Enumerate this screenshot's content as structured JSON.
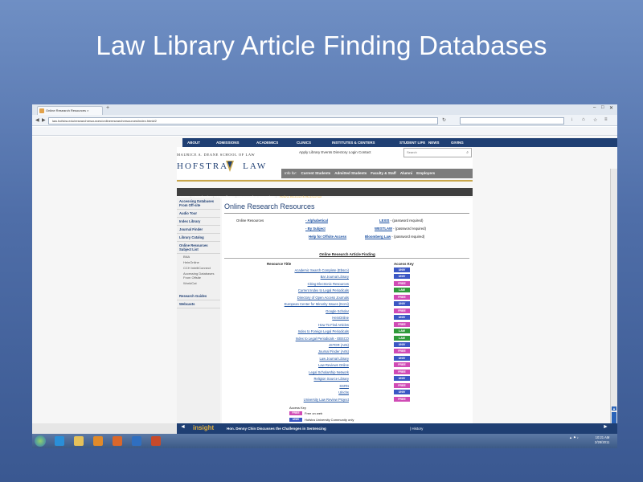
{
  "slide": {
    "title": "Law Library Article Finding Databases"
  },
  "browser": {
    "tab_title": "Online Research Resources ×",
    "new_tab": "+",
    "url": "law.hofstra.edu/researchresources/onlineresearchresources/index.html#2",
    "bookmarks": [
      "Hofstra Portal",
      "Hofstra Law School",
      "Deane Law Library",
      "Lexis",
      "Online Databases",
      "LexisNexis",
      "PBWiki",
      "HeinOnline",
      "Westlaw",
      "Worldcat",
      "Journal Finder",
      "Bluebook",
      "Most Visited",
      "Getting Started",
      "Latest Headlines",
      "Most Visited",
      "LibGuides Law Index"
    ]
  },
  "site": {
    "topnav": [
      "ABOUT",
      "ADMISSIONS",
      "ACADEMICS",
      "CLINICS",
      "INSTITUTES & CENTERS",
      "STUDENT LIFE",
      "NEWS",
      "GIVING"
    ],
    "school_name": "MAURICE A. DEANE SCHOOL OF LAW",
    "wordmark_left": "HOFSTRA",
    "wordmark_right": "LAW",
    "utility_links": "Apply   Library   Events   Directory   Login   Contact",
    "search_placeholder": "Search",
    "audience_label": "Info for:",
    "audience": [
      "Current Students",
      "Admitted Students",
      "Faculty & Staff",
      "Alumni",
      "Employers"
    ],
    "breadcrumb": [
      "Home",
      "Academics",
      "Law Library",
      "Research & Instruction",
      "Online Research Resources"
    ],
    "sidebar": {
      "items": [
        "Accessing Databases From Off-site",
        "Audio Tour",
        "Index Library",
        "Journal Finder",
        "Library Catalog",
        "Online Resources Subject List"
      ],
      "subitems": [
        "BNA",
        "HeinOnline",
        "CCH IntelliConnect",
        "Accessing Databases From Offsite",
        "WorldCat"
      ],
      "lower_items": [
        "Research Guides",
        "Webcasts"
      ]
    },
    "content": {
      "heading": "Online Research Resources",
      "or_label": "Online Resources",
      "or_links": [
        "- Alphabetical",
        "- By Subject",
        "Help for Offsite Access"
      ],
      "lexis": "LEXIS",
      "lexis_note": " - (password required)",
      "westlaw": "WESTLAW",
      "westlaw_note": " - (password required)",
      "bloomberg": "Bloomberg Law",
      "bloomberg_note": " - (password required)",
      "finding_title": "Online Research Article Finding",
      "col_title": "Resource Title",
      "col_key": "Access Key",
      "rows": [
        {
          "name": "Academic Search Complete (Ebsco)",
          "key": "UNIV"
        },
        {
          "name": "Bar Journal Library",
          "key": "UNIV"
        },
        {
          "name": "Citing Electronic Resources",
          "key": "FREE"
        },
        {
          "name": "Current Index to Legal Periodicals",
          "key": "LAW"
        },
        {
          "name": "Directory of Open Access Journals",
          "key": "FREE"
        },
        {
          "name": "European Center for Minority Issues (Ecmi)",
          "key": "UNIV"
        },
        {
          "name": "Google Scholar",
          "key": "FREE"
        },
        {
          "name": "HeinOnline",
          "key": "UNIV"
        },
        {
          "name": "How To Find Articles",
          "key": "FREE"
        },
        {
          "name": "Index to Foreign Legal Periodicals",
          "key": "LAW"
        },
        {
          "name": "Index to Legal Periodicals - EBSCO",
          "key": "LAW"
        },
        {
          "name": "JSTOR (Arts)",
          "key": "UNIV"
        },
        {
          "name": "Journal Finder (Arts)",
          "key": "FREE"
        },
        {
          "name": "Law Journal Library",
          "key": "UNIV"
        },
        {
          "name": "Law Reviews Online",
          "key": "FREE"
        },
        {
          "name": "Legal Scholarship Network",
          "key": "FREE"
        },
        {
          "name": "Religion Source Library",
          "key": "UNIV"
        },
        {
          "name": "SSRN",
          "key": "FREE"
        },
        {
          "name": "Ulrichs",
          "key": "UNIV"
        },
        {
          "name": "University Law Review Project",
          "key": "FREE"
        }
      ],
      "legend_title": "Access Key",
      "legend": [
        {
          "label": "FREE",
          "text": "Free on web"
        },
        {
          "label": "UNIV",
          "text": "Hofstra University Community only"
        }
      ]
    },
    "footer": {
      "logo": "insight",
      "prev": "◄",
      "text": "Hon. Denny Chin Discusses the Challenges in Sentencing",
      "sep": "| History",
      "next": "►"
    }
  },
  "taskbar": {
    "time": "10:21 AM",
    "date": "2/28/2011"
  },
  "colors": {
    "free": "#d04bb5",
    "univ": "#3b57c4",
    "law": "#2f9a3a",
    "navy": "#1f3f73",
    "gold": "#c8a64b"
  }
}
